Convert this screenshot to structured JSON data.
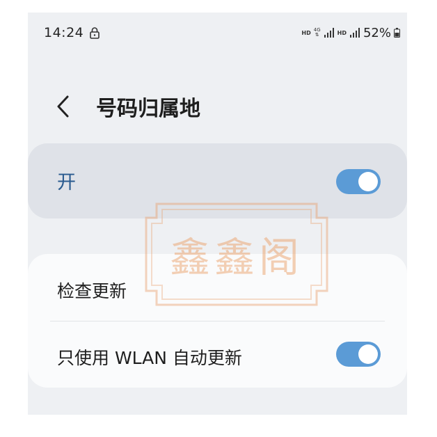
{
  "status_bar": {
    "time": "14:24",
    "hd_label_1": "HD",
    "net_type_top": "4G",
    "net_type_bottom": "⇅",
    "hd_label_2": "HD",
    "battery_percent": "52%"
  },
  "header": {
    "title": "号码归属地"
  },
  "master_switch": {
    "label": "开",
    "on": true
  },
  "settings": {
    "items": [
      {
        "label": "检查更新"
      },
      {
        "label": "只使用 WLAN 自动更新",
        "toggle_on": true
      }
    ]
  },
  "watermark": {
    "text": "鑫鑫阁"
  },
  "colors": {
    "accent": "#5b9bd6",
    "master_label": "#2a5b8f",
    "background": "#eef0f3",
    "master_card": "#dfe2e8",
    "card": "#fafbfc"
  }
}
